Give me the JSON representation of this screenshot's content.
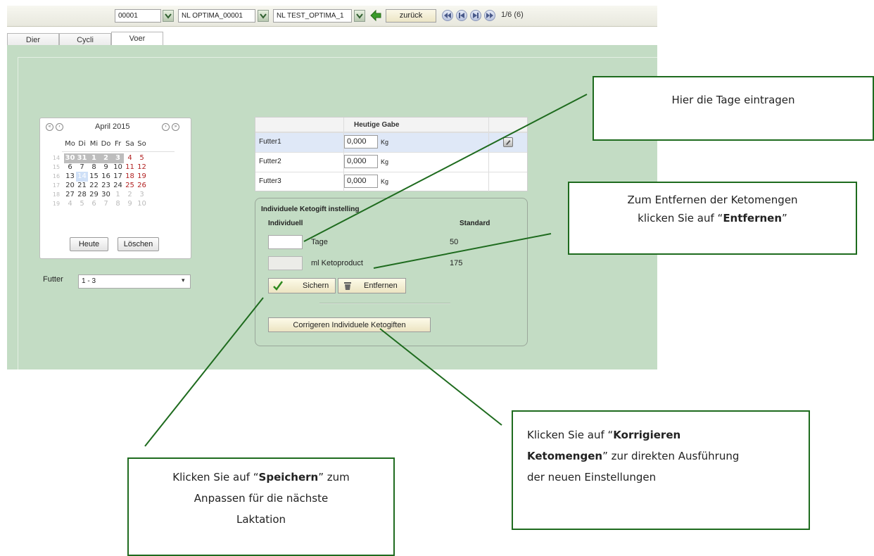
{
  "toolbar": {
    "field1": "00001",
    "field2": "NL OPTIMA_00001",
    "field3": "NL TEST_OPTIMA_1",
    "back_label": "zurück",
    "page_indicator": "1/6 (6)"
  },
  "tabs": [
    {
      "label": "Dier"
    },
    {
      "label": "Cycli"
    },
    {
      "label": "Voer"
    }
  ],
  "calendar": {
    "month_label": "April 2015",
    "weekdays": [
      "Mo",
      "Di",
      "Mi",
      "Do",
      "Fr",
      "Sa",
      "So"
    ],
    "weeks": [
      {
        "num": "14",
        "days": [
          "30",
          "31",
          "1",
          "2",
          "3",
          "4",
          "5"
        ]
      },
      {
        "num": "15",
        "days": [
          "6",
          "7",
          "8",
          "9",
          "10",
          "11",
          "12"
        ]
      },
      {
        "num": "16",
        "days": [
          "13",
          "14",
          "15",
          "16",
          "17",
          "18",
          "19"
        ]
      },
      {
        "num": "17",
        "days": [
          "20",
          "21",
          "22",
          "23",
          "24",
          "25",
          "26"
        ]
      },
      {
        "num": "18",
        "days": [
          "27",
          "28",
          "29",
          "30",
          "1",
          "2",
          "3"
        ]
      },
      {
        "num": "19",
        "days": [
          "4",
          "5",
          "6",
          "7",
          "8",
          "9",
          "10"
        ]
      }
    ],
    "selected_day": "14",
    "today_button": "Heute",
    "clear_button": "Löschen"
  },
  "futter": {
    "label": "Futter",
    "selected": "1 - 3"
  },
  "feed_table": {
    "header": "Heutige Gabe",
    "rows": [
      {
        "name": "Futter1",
        "value": "0,000",
        "unit": "Kg"
      },
      {
        "name": "Futter2",
        "value": "0,000",
        "unit": "Kg"
      },
      {
        "name": "Futter3",
        "value": "0,000",
        "unit": "Kg"
      }
    ]
  },
  "keto": {
    "title": "Individuele Ketogift instelling",
    "col_individual": "Individuell",
    "col_standard": "Standard",
    "rows": [
      {
        "label": "Tage",
        "standard": "50"
      },
      {
        "label": "ml Ketoproduct",
        "standard": "175"
      }
    ],
    "save_button": "Sichern",
    "remove_button": "Entfernen",
    "correct_button": "Corrigeren Individuele Ketogiften"
  },
  "callouts": {
    "c1": "Hier die Tage eintragen",
    "c2_line1": "Zum Entfernen der Ketomengen",
    "c2_pre": "klicken Sie auf “",
    "c2_bold": "Entfernen",
    "c2_post": "”",
    "c3_pre": "Klicken Sie auf “",
    "c3_bold1": "Korrigieren",
    "c3_bold2": "Ketomengen",
    "c3_post": "” zur direkten Ausführung",
    "c3_line3": "der neuen Einstellungen",
    "c4_pre": "Klicken Sie auf “",
    "c4_bold": "Speichern",
    "c4_post": "” zum",
    "c4_line2": "Anpassen für die nächste",
    "c4_line3": "Laktation"
  },
  "colors": {
    "panel_bg": "#c3dcc4",
    "callout_border": "#1e6b1e",
    "weekend_red": "#b22222",
    "selected_blue": "#cfe0f7"
  }
}
